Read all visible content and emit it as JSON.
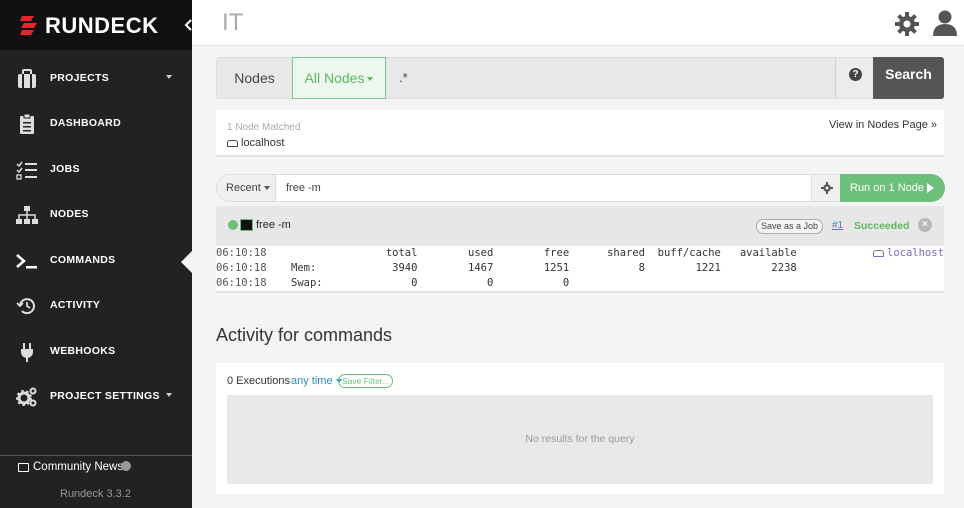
{
  "brand": {
    "name": "RUNDECK",
    "accent": "#e8242d"
  },
  "sidebar": {
    "items": [
      {
        "label": "PROJECTS",
        "icon": "briefcase-icon",
        "has_caret": true
      },
      {
        "label": "DASHBOARD",
        "icon": "clipboard-icon",
        "has_caret": false
      },
      {
        "label": "JOBS",
        "icon": "tasks-icon",
        "has_caret": false
      },
      {
        "label": "NODES",
        "icon": "sitemap-icon",
        "has_caret": false
      },
      {
        "label": "COMMANDS",
        "icon": "terminal-icon",
        "has_caret": false,
        "active": true
      },
      {
        "label": "ACTIVITY",
        "icon": "history-icon",
        "has_caret": false
      },
      {
        "label": "WEBHOOKS",
        "icon": "plug-icon",
        "has_caret": false
      },
      {
        "label": "PROJECT SETTINGS",
        "icon": "cogs-icon",
        "has_caret": true
      }
    ],
    "community_news": "Community News",
    "version": "Rundeck 3.3.2"
  },
  "header": {
    "project": "IT"
  },
  "node_filter": {
    "label": "Nodes",
    "dropdown": "All Nodes",
    "value": ".*",
    "search_label": "Search",
    "help_glyph": "?"
  },
  "matched": {
    "count_text": "1 Node Matched",
    "node": "localhost",
    "view_link": "View in Nodes Page »"
  },
  "command": {
    "recent_label": "Recent",
    "value": "free -m",
    "run_label": "Run on 1 Node"
  },
  "execution": {
    "command": "free -m",
    "save_job": "Save as a Job",
    "number": "#1",
    "result": "Succeeded",
    "node": "localhost",
    "lines": [
      {
        "time": "06:10:18",
        "text": "               total        used        free      shared  buff/cache   available"
      },
      {
        "time": "06:10:18",
        "text": "Mem:            3940        1467        1251           8        1221        2238"
      },
      {
        "time": "06:10:18",
        "text": "Swap:              0           0           0"
      }
    ]
  },
  "activity": {
    "title": "Activity for commands",
    "count": "0 Executions",
    "time_filter": "any time",
    "save_filter": "Save Filter...",
    "empty": "No results for the query"
  },
  "colors": {
    "success": "#5cb85c",
    "link": "#2a8fbd",
    "sidebar_bg": "#222222"
  }
}
